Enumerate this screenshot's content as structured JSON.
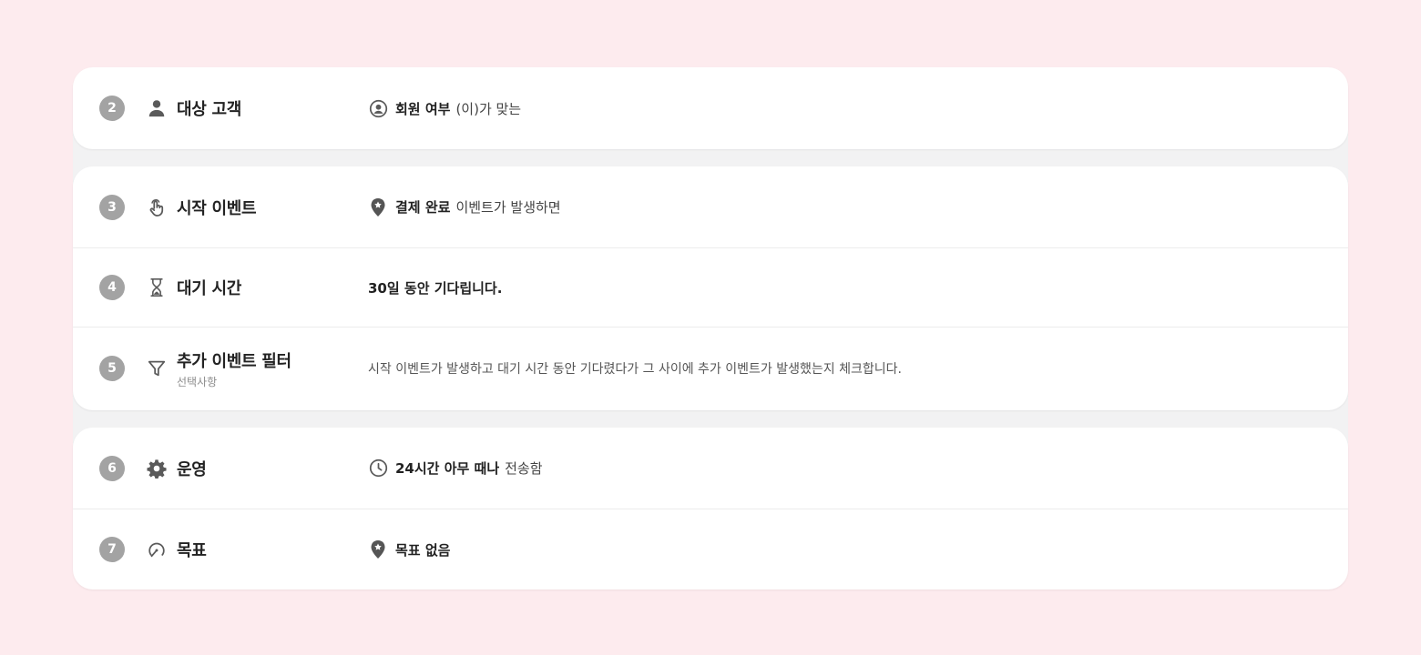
{
  "colors": {
    "page_background": "#fdebee",
    "panel_background": "#ffffff",
    "step_badge": "#a3a3a3",
    "icon": "#5a5a5a"
  },
  "steps": [
    {
      "number": "2",
      "icon": "person-icon",
      "title": "대상 고객",
      "detail": {
        "icon": "user-circle-icon",
        "strong": "회원 여부",
        "text": "(이)가 맞는"
      }
    },
    {
      "number": "3",
      "icon": "tap-hand-icon",
      "title": "시작 이벤트",
      "detail": {
        "icon": "location-pin-icon",
        "strong": "결제 완료",
        "text": "이벤트가 발생하면"
      }
    },
    {
      "number": "4",
      "icon": "hourglass-icon",
      "title": "대기 시간",
      "detail": {
        "strong": "30일 동안 기다립니다."
      }
    },
    {
      "number": "5",
      "icon": "filter-icon",
      "title": "추가 이벤트 필터",
      "subtitle": "선택사항",
      "detail": {
        "text": "시작 이벤트가 발생하고 대기 시간 동안 기다렸다가 그 사이에 추가 이벤트가 발생했는지 체크합니다."
      }
    },
    {
      "number": "6",
      "icon": "gear-icon",
      "title": "운영",
      "detail": {
        "icon": "clock-icon",
        "strong": "24시간 아무 때나",
        "text": "전송함"
      }
    },
    {
      "number": "7",
      "icon": "goal-gauge-icon",
      "title": "목표",
      "detail": {
        "icon": "location-pin-icon",
        "strong": "목표 없음"
      }
    }
  ]
}
